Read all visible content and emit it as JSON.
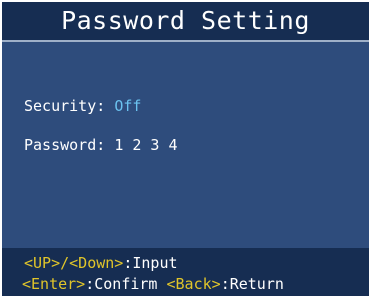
{
  "header": {
    "title": "Password Setting"
  },
  "settings": {
    "security": {
      "label": "Security:",
      "value": "Off"
    },
    "password": {
      "label": "Password:",
      "value": "1 2 3 4"
    }
  },
  "footer": {
    "hints": [
      {
        "key_up": "<UP>",
        "sep": "/",
        "key_down": "<Down>",
        "action": ":Input"
      },
      {
        "key_enter": "<Enter>",
        "action_confirm": ":Confirm",
        "key_back": "<Back>",
        "action_return": ":Return"
      }
    ]
  },
  "colors": {
    "title_bg": "#162d52",
    "panel_bg": "#2e4c7c",
    "value_accent": "#6bc3f0",
    "key_accent": "#e0c52a",
    "text": "#ffffff"
  }
}
